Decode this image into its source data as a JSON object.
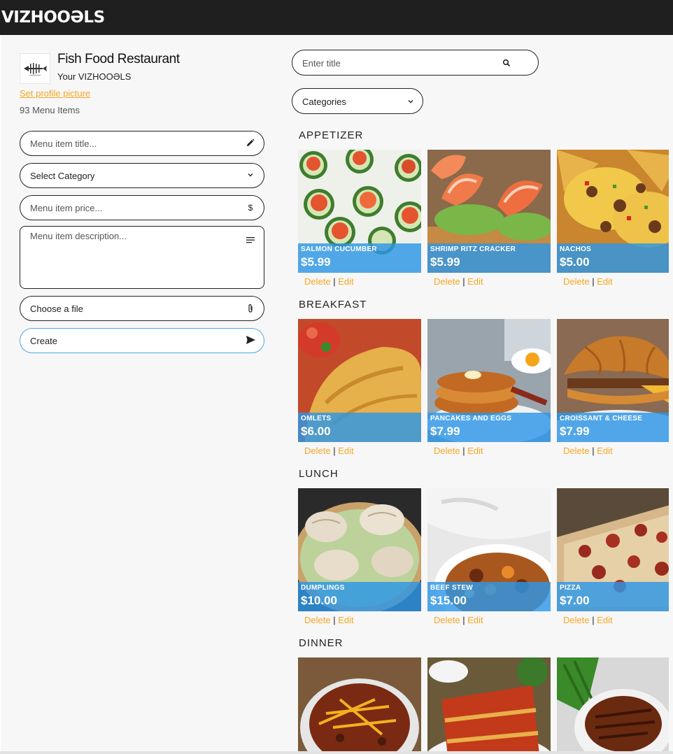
{
  "brand": {
    "logo_text": "VIZHOOƏLS"
  },
  "profile": {
    "restaurant_name": "Fish Food Restaurant",
    "subtitle": "Your VIZHOOƏLS",
    "set_picture_label": "Set profile picture",
    "menu_count": "93 Menu Items"
  },
  "form": {
    "title_placeholder": "Menu item title...",
    "category_label": "Select Category",
    "price_placeholder": "Menu item price...",
    "description_placeholder": "Menu item description...",
    "file_label": "Choose a file",
    "create_label": "Create"
  },
  "search": {
    "placeholder": "Enter title",
    "categories_label": "Categories"
  },
  "actions": {
    "delete": "Delete",
    "sep": "|",
    "edit": "Edit"
  },
  "sections": [
    {
      "title": "APPETIZER",
      "items": [
        {
          "name": "SALMON CUCUMBER",
          "price": "$5.99"
        },
        {
          "name": "SHRIMP RITZ CRACKER",
          "price": "$5.99"
        },
        {
          "name": "NACHOS",
          "price": "$5.00"
        }
      ]
    },
    {
      "title": "BREAKFAST",
      "items": [
        {
          "name": "OMLETS",
          "price": "$6.00"
        },
        {
          "name": "PANCAKES AND EGGS",
          "price": "$7.99"
        },
        {
          "name": "CROISSANT & CHEESE",
          "price": "$7.99"
        }
      ]
    },
    {
      "title": "LUNCH",
      "items": [
        {
          "name": "DUMPLINGS",
          "price": "$10.00"
        },
        {
          "name": "BEEF STEW",
          "price": "$15.00"
        },
        {
          "name": "PIZZA",
          "price": "$7.00"
        }
      ]
    },
    {
      "title": "DINNER",
      "items": []
    }
  ],
  "colors": {
    "accent": "#f5a623",
    "band": "#2d96e6",
    "topbar": "#1f1f1f"
  }
}
